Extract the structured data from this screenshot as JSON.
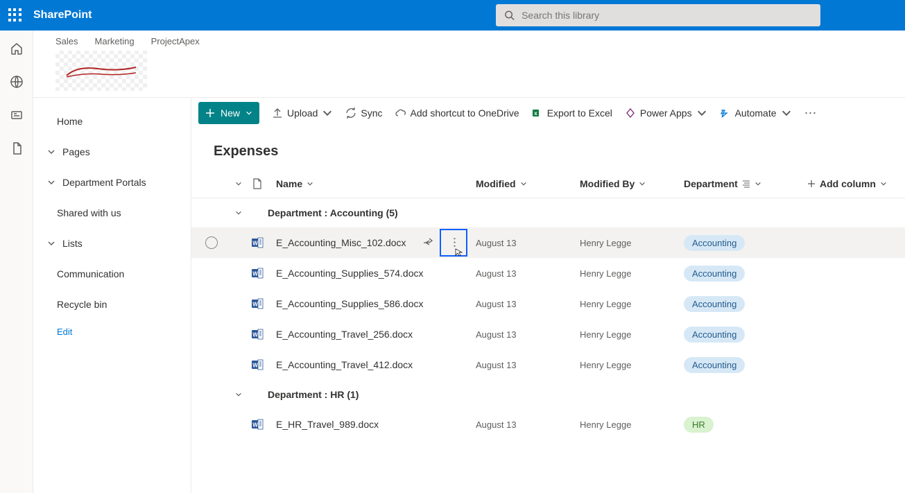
{
  "header": {
    "brand": "SharePoint",
    "search_placeholder": "Search this library"
  },
  "hub": {
    "tabs": [
      "Sales",
      "Marketing",
      "ProjectApex"
    ]
  },
  "nav": {
    "home": "Home",
    "pages": "Pages",
    "portals": "Department Portals",
    "shared": "Shared with us",
    "lists": "Lists",
    "communication": "Communication",
    "recycle": "Recycle bin",
    "edit": "Edit"
  },
  "cmd": {
    "new": "New",
    "upload": "Upload",
    "sync": "Sync",
    "shortcut": "Add shortcut to OneDrive",
    "export": "Export to Excel",
    "powerapps": "Power Apps",
    "automate": "Automate"
  },
  "library": {
    "title": "Expenses"
  },
  "columns": {
    "name": "Name",
    "modified": "Modified",
    "modifiedBy": "Modified By",
    "department": "Department",
    "addColumn": "Add column"
  },
  "groups": [
    {
      "label": "Department : Accounting (5)",
      "rows": [
        {
          "name": "E_Accounting_Misc_102.docx",
          "modified": "August 13",
          "modifiedBy": "Henry Legge",
          "dept": "Accounting",
          "deptClass": "acct",
          "hover": true
        },
        {
          "name": "E_Accounting_Supplies_574.docx",
          "modified": "August 13",
          "modifiedBy": "Henry Legge",
          "dept": "Accounting",
          "deptClass": "acct"
        },
        {
          "name": "E_Accounting_Supplies_586.docx",
          "modified": "August 13",
          "modifiedBy": "Henry Legge",
          "dept": "Accounting",
          "deptClass": "acct"
        },
        {
          "name": "E_Accounting_Travel_256.docx",
          "modified": "August 13",
          "modifiedBy": "Henry Legge",
          "dept": "Accounting",
          "deptClass": "acct"
        },
        {
          "name": "E_Accounting_Travel_412.docx",
          "modified": "August 13",
          "modifiedBy": "Henry Legge",
          "dept": "Accounting",
          "deptClass": "acct"
        }
      ]
    },
    {
      "label": "Department : HR (1)",
      "rows": [
        {
          "name": "E_HR_Travel_989.docx",
          "modified": "August 13",
          "modifiedBy": "Henry Legge",
          "dept": "HR",
          "deptClass": "hr"
        }
      ]
    }
  ]
}
